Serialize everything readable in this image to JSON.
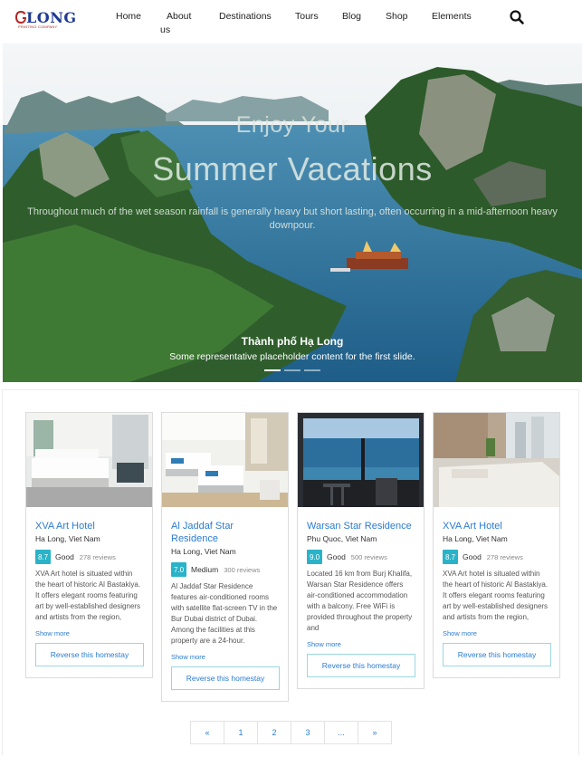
{
  "brand": {
    "logo_text": "LONG",
    "logo_subtext": "PRINTING COMPANY"
  },
  "nav": {
    "items": [
      "Home",
      "About us",
      "Destinations",
      "Tours",
      "Blog",
      "Shop",
      "Elements"
    ]
  },
  "hero": {
    "kicker": "Enjoy Your",
    "title": "Summer Vacations",
    "description": "Throughout much of the wet season rainfall is generally heavy but short lasting, often occurring in a mid-afternoon heavy downpour.",
    "caption_title": "Thành phố Hạ Long",
    "caption_text": "Some representative placeholder content for the first slide."
  },
  "hotels": [
    {
      "name": "XVA Art Hotel",
      "location": "Ha Long, Viet Nam",
      "score": "8.7",
      "rating_label": "Good",
      "reviews": "278 reviews",
      "description": "XVA Art hotel is situated within the heart of historic Al Bastakiya. It offers elegant rooms featuring art by well-established designers and artists from the region,",
      "show_more": "Show more",
      "button": "Reverse this homestay"
    },
    {
      "name": "Al Jaddaf Star Residence",
      "location": "Ha Long, Viet Nam",
      "score": "7.0",
      "rating_label": "Medium",
      "reviews": "300 reviews",
      "description": "Al Jaddaf Star Residence features air-conditioned rooms with satellite flat-screen TV in the Bur Dubai district of Dubai. Among the facilities at this property are a 24-hour.",
      "show_more": "Show more",
      "button": "Reverse this homestay"
    },
    {
      "name": "Warsan Star Residence",
      "location": "Phu Quoc, Viet Nam",
      "score": "9.0",
      "rating_label": "Good",
      "reviews": "500 reviews",
      "description": "Located 16 km from Burj Khalifa, Warsan Star Residence offers air-conditioned accommodation with a balcony. Free WiFi is provided throughout the property and",
      "show_more": "Show more",
      "button": "Reverse this homestay"
    },
    {
      "name": "XVA Art Hotel",
      "location": "Ha Long, Viet Nam",
      "score": "8.7",
      "rating_label": "Good",
      "reviews": "278 reviews",
      "description": "XVA Art hotel is situated within the heart of historic Al Bastakiya. It offers elegant rooms featuring art by well-established designers and artists from the region,",
      "show_more": "Show more",
      "button": "Reverse this homestay"
    }
  ],
  "pagination": [
    "«",
    "1",
    "2",
    "3",
    "...",
    "»"
  ],
  "colors": {
    "link": "#2b7cd3",
    "score_badge": "#2ab3c8",
    "brand": "#1f3a93"
  }
}
